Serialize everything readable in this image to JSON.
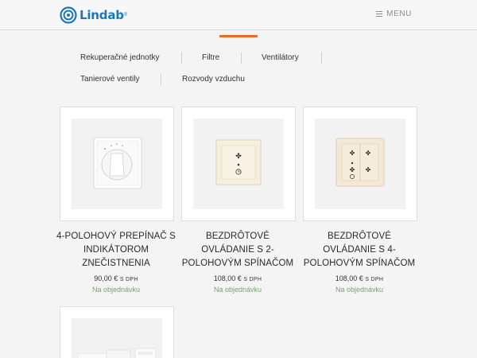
{
  "brand": {
    "name": "Lindab",
    "reg": "®"
  },
  "header": {
    "menu_label": "MENU"
  },
  "categories": [
    "Rekuperačné jednotky",
    "Filtre",
    "Ventilátory",
    "Tanierové ventily",
    "Rozvody vzduchu"
  ],
  "products": [
    {
      "title_lines": [
        "4-POLOHOVÝ PREPÍNAČ S",
        "INDIKÁTOROM",
        "ZNEČISTNENIA"
      ],
      "price": "90,00 €",
      "price_suffix": "S DPH",
      "availability": "Na objednávku"
    },
    {
      "title_lines": [
        "BEZDRÔTOVÉ",
        "OVLÁDANIE S 2-",
        "POLOHOVÝM SPÍNAČOM"
      ],
      "price": "108,00 €",
      "price_suffix": "S DPH",
      "availability": "Na objednávku"
    },
    {
      "title_lines": [
        "BEZDRÔTOVÉ",
        "OVLÁDANIE S 4-",
        "POLOHOVÝM SPÍNAČOM"
      ],
      "price": "108,00 €",
      "price_suffix": "S DPH",
      "availability": "Na objednávku"
    }
  ],
  "colors": {
    "brand_blue": "#1a78b8",
    "accent_orange": "#ea6a2a",
    "availability_green": "#7ba36e"
  }
}
